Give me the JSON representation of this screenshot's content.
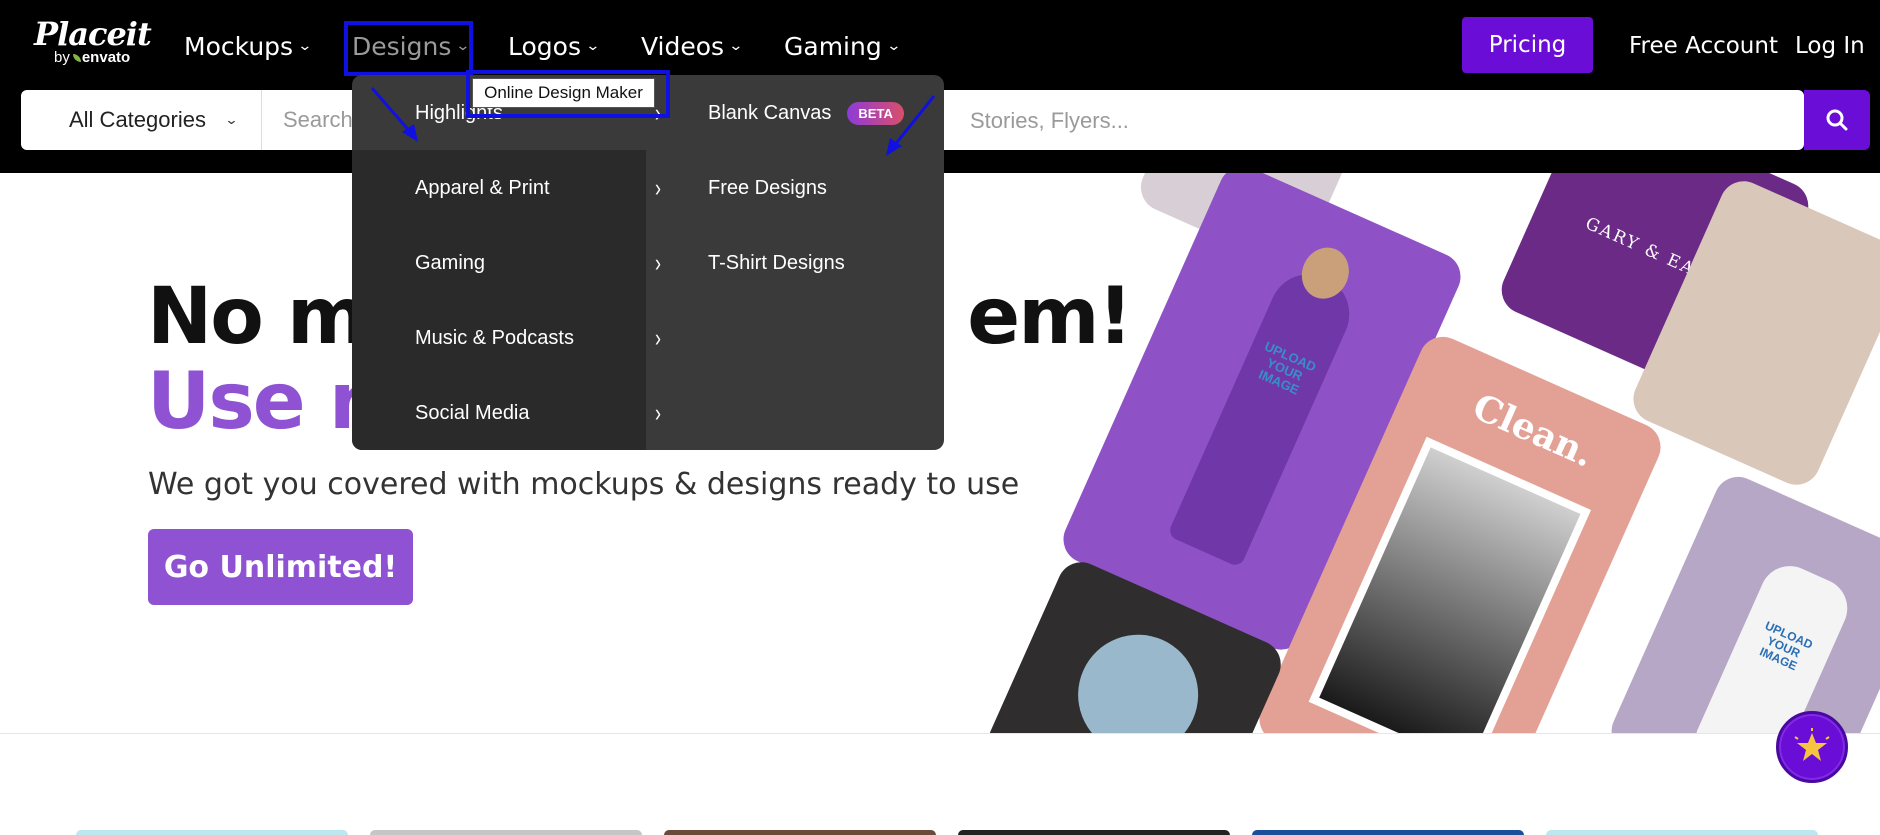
{
  "logo": {
    "brand": "Placeit",
    "by": "by",
    "envato": "envato"
  },
  "nav": {
    "mockups": "Mockups",
    "designs": "Designs",
    "logos": "Logos",
    "videos": "Videos",
    "gaming": "Gaming"
  },
  "header": {
    "pricing": "Pricing",
    "free_account": "Free Account",
    "login": "Log In"
  },
  "search": {
    "category": "All Categories",
    "placeholder": "Search",
    "placeholder_tail": "Stories, Flyers..."
  },
  "dropdown": {
    "tooltip": "Online Design Maker",
    "categories": [
      {
        "label": "Highlights"
      },
      {
        "label": "Apparel & Print"
      },
      {
        "label": "Gaming"
      },
      {
        "label": "Music & Podcasts"
      },
      {
        "label": "Social Media"
      }
    ],
    "links": [
      {
        "label": "Blank Canvas",
        "badge": "BETA"
      },
      {
        "label": "Free Designs"
      },
      {
        "label": "T-Shirt Designs"
      }
    ]
  },
  "hero": {
    "line1_a": "No m",
    "line1_b": "em!",
    "line2": "Use n",
    "subtitle": "We got you covered with mockups & designs ready to use",
    "cta": "Go Unlimited!"
  },
  "collage": {
    "tile_clean": "Clean.",
    "tile_gary": "GARY & EARL",
    "tile_upload1": "UPLOAD YOUR IMAGE",
    "tile_upload2": "UPLOAD YOUR IMAGE"
  },
  "colors": {
    "accent": "#6a0dd6",
    "brand_purple": "#8e52d3",
    "highlight_box": "#1010e0"
  }
}
